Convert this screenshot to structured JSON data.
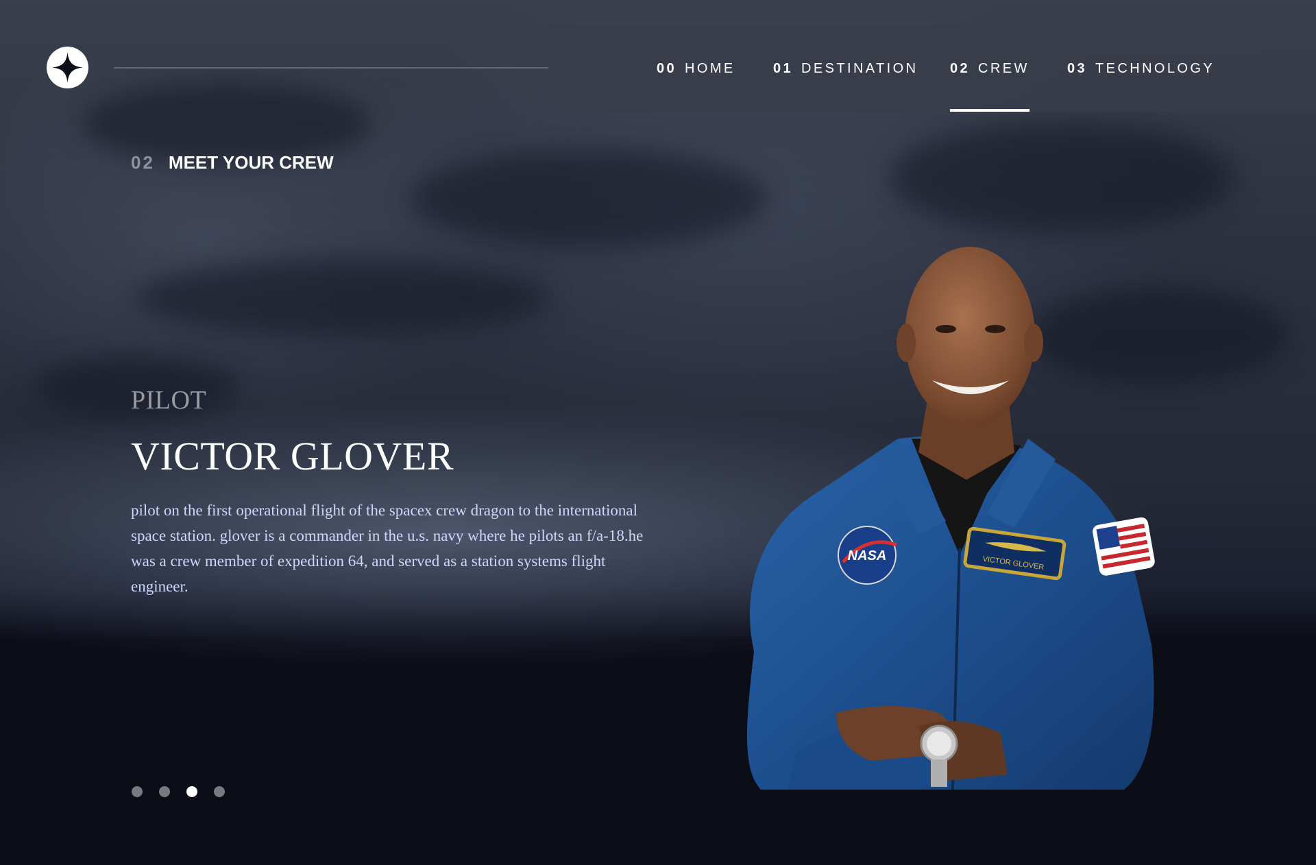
{
  "nav": {
    "items": [
      {
        "num": "00",
        "label": "HOME"
      },
      {
        "num": "01",
        "label": "DESTINATION"
      },
      {
        "num": "02",
        "label": "CREW"
      },
      {
        "num": "03",
        "label": "TECHNOLOGY"
      }
    ],
    "active_index": 2
  },
  "section": {
    "num": "02",
    "title": "MEET YOUR CREW"
  },
  "crew": {
    "role": "PILOT",
    "name": "VICTOR GLOVER",
    "bio": "pilot on the first operational flight of the spacex crew dragon to the international space station. glover is a commander in the u.s. navy where he pilots an f/a-18.he was a crew member of expedition 64, and served as a station systems flight engineer.",
    "patch_nasa": "NASA",
    "patch_name": "VICTOR GLOVER"
  },
  "pagination": {
    "count": 4,
    "active_index": 2
  },
  "colors": {
    "background": "#0b0d17",
    "text": "#ffffff",
    "body_text": "#d0d6f9",
    "suit": "#1d4f8f"
  },
  "icons": {
    "logo": "four-point-star-logo-icon"
  }
}
